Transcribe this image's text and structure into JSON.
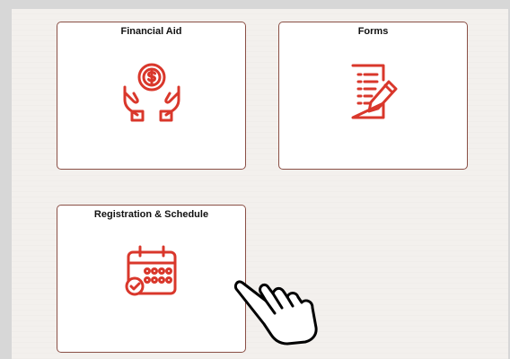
{
  "tiles": [
    {
      "title": "Financial Aid",
      "icon": "hands-dollar-coin-icon"
    },
    {
      "title": "Forms",
      "icon": "document-pencil-icon"
    },
    {
      "title": "Registration & Schedule",
      "icon": "calendar-check-icon"
    }
  ],
  "colors": {
    "accent": "#d9372b",
    "tile_border": "#8a4f45",
    "background": "#f3f0ed"
  }
}
